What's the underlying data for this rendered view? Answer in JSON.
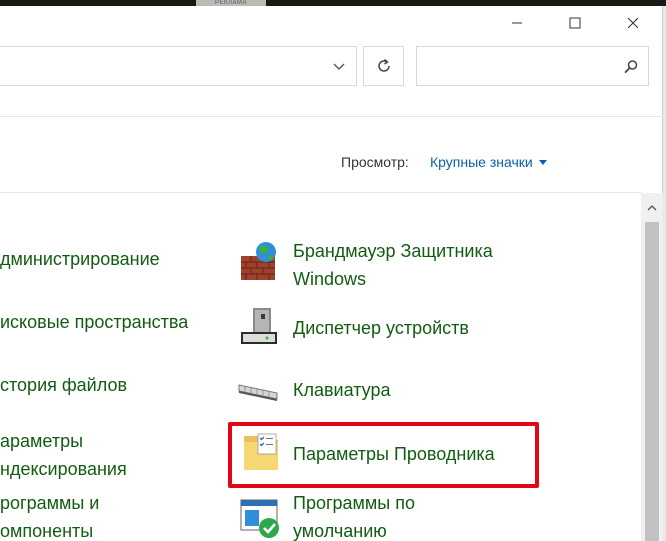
{
  "background": {
    "ad_label": "РЕКЛАМА"
  },
  "window": {
    "controls": {
      "minimize_icon": "minimize-icon",
      "maximize_icon": "maximize-icon",
      "close_icon": "close-icon"
    },
    "address": {
      "dropdown_icon": "chevron-down-icon",
      "refresh_icon": "refresh-icon"
    },
    "search": {
      "value": "",
      "placeholder": "",
      "icon": "search-icon"
    }
  },
  "view": {
    "label": "Просмотр:",
    "value": "Крупные значки"
  },
  "items_left": [
    {
      "label": "дминистрирование"
    },
    {
      "label": "исковые пространства"
    },
    {
      "label": "стория файлов"
    },
    {
      "label_line1": "араметры",
      "label_line2": "ндексирования"
    },
    {
      "label_line1": "рограммы и",
      "label_line2": "омпоненты"
    }
  ],
  "items_right": [
    {
      "icon": "firewall-icon",
      "label_line1": "Брандмауэр Защитника",
      "label_line2": "Windows"
    },
    {
      "icon": "device-manager-icon",
      "label": "Диспетчер устройств"
    },
    {
      "icon": "keyboard-icon",
      "label": "Клавиатура"
    },
    {
      "icon": "folder-options-icon",
      "label": "Параметры Проводника"
    },
    {
      "icon": "default-programs-icon",
      "label_line1": "Программы по",
      "label_line2": "умолчанию"
    }
  ],
  "colors": {
    "link_green": "#125c12",
    "accent_blue": "#0b5fb0",
    "highlight_red": "#e30613"
  }
}
